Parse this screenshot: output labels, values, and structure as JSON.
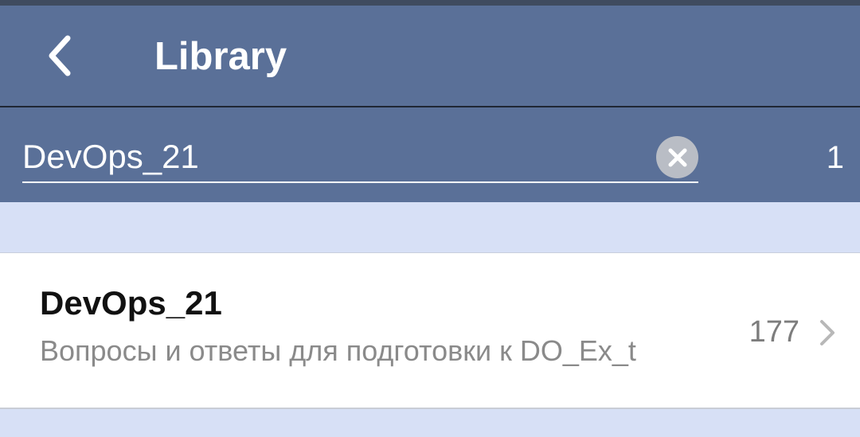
{
  "header": {
    "title": "Library",
    "back_icon": "chevron-left-icon"
  },
  "search": {
    "value": "DevOps_21",
    "placeholder": "",
    "clear_icon": "clear-icon",
    "result_count": "1"
  },
  "results": [
    {
      "title": "DevOps_21",
      "description": "Вопросы и ответы для подготовки к DO_Ex_t",
      "count": "177",
      "chevron_icon": "chevron-right-icon"
    }
  ],
  "colors": {
    "header_bg": "#5a7098",
    "page_bg": "#d7e0f6",
    "card_bg": "#ffffff"
  }
}
